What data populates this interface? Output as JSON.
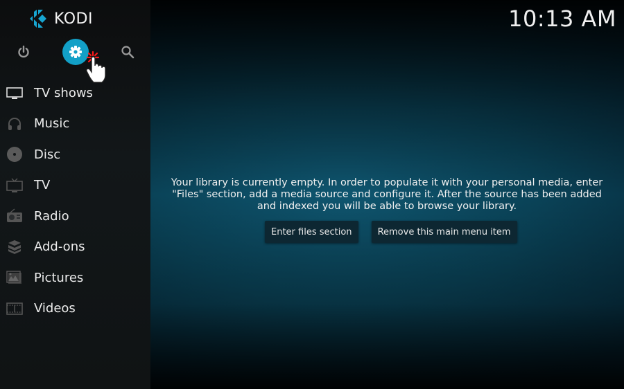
{
  "app": {
    "name": "KODI",
    "clock": "10:13 AM"
  },
  "colors": {
    "accent": "#12a0c7",
    "sidebar_bg": "#111618",
    "content_bg": "#0c4a5e"
  },
  "top_buttons": [
    {
      "name": "power",
      "icon": "power-icon"
    },
    {
      "name": "settings",
      "icon": "gear-icon",
      "selected": true
    },
    {
      "name": "search",
      "icon": "search-icon"
    }
  ],
  "menu": {
    "items": [
      {
        "label": "TV shows",
        "icon": "tv-shows-icon"
      },
      {
        "label": "Music",
        "icon": "headphones-icon"
      },
      {
        "label": "Disc",
        "icon": "disc-icon"
      },
      {
        "label": "TV",
        "icon": "tv-icon"
      },
      {
        "label": "Radio",
        "icon": "radio-icon"
      },
      {
        "label": "Add-ons",
        "icon": "addons-box-icon"
      },
      {
        "label": "Pictures",
        "icon": "pictures-icon"
      },
      {
        "label": "Videos",
        "icon": "film-icon"
      }
    ]
  },
  "content": {
    "message": "Your library is currently empty. In order to populate it with your personal media, enter \"Files\" section, add a media source and configure it. After the source has been added and indexed you will be able to browse your library.",
    "buttons": {
      "enter_files": "Enter files section",
      "remove_item": "Remove this main menu item"
    }
  }
}
